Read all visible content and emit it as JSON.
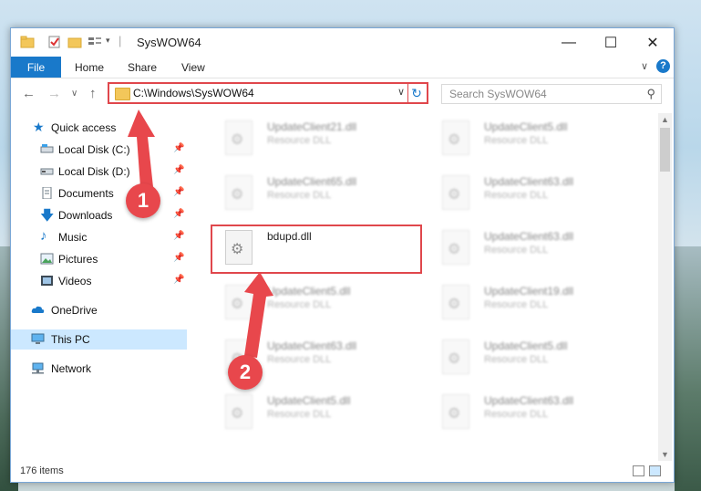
{
  "window": {
    "title": "SysWOW64"
  },
  "ribbon": {
    "file": "File",
    "home": "Home",
    "share": "Share",
    "view": "View",
    "help": "?"
  },
  "address": {
    "path": "C:\\Windows\\SysWOW64"
  },
  "search": {
    "placeholder": "Search SysWOW64"
  },
  "sidebar": {
    "items": [
      {
        "label": "Quick access",
        "icon": "star-icon"
      },
      {
        "label": "Local Disk (C:)",
        "icon": "disk-icon"
      },
      {
        "label": "Local Disk (D:)",
        "icon": "disk-icon"
      },
      {
        "label": "Documents",
        "icon": "documents-icon"
      },
      {
        "label": "Downloads",
        "icon": "download-icon"
      },
      {
        "label": "Music",
        "icon": "music-icon"
      },
      {
        "label": "Pictures",
        "icon": "pictures-icon"
      },
      {
        "label": "Videos",
        "icon": "videos-icon"
      },
      {
        "label": "OneDrive",
        "icon": "cloud-icon"
      },
      {
        "label": "This PC",
        "icon": "computer-icon"
      },
      {
        "label": "Network",
        "icon": "network-icon"
      }
    ]
  },
  "files": {
    "left": [
      {
        "name": "UpdateClient21.dll",
        "desc": "Resource DLL"
      },
      {
        "name": "UpdateClient65.dll",
        "desc": "Resource DLL"
      },
      {
        "name": "bdupd.dll",
        "desc": ""
      },
      {
        "name": "UpdateClient5.dll",
        "desc": "Resource DLL"
      },
      {
        "name": "UpdateClient63.dll",
        "desc": "Resource DLL"
      },
      {
        "name": "UpdateClient5.dll",
        "desc": "Resource DLL"
      }
    ],
    "right": [
      {
        "name": "UpdateClient5.dll",
        "desc": "Resource DLL"
      },
      {
        "name": "UpdateClient63.dll",
        "desc": "Resource DLL"
      },
      {
        "name": "UpdateClient63.dll",
        "desc": "Resource DLL"
      },
      {
        "name": "UpdateClient19.dll",
        "desc": "Resource DLL"
      },
      {
        "name": "UpdateClient5.dll",
        "desc": "Resource DLL"
      },
      {
        "name": "UpdateClient63.dll",
        "desc": "Resource DLL"
      }
    ]
  },
  "status": {
    "count": "176 items"
  },
  "callouts": {
    "one": "1",
    "two": "2"
  },
  "colors": {
    "accent": "#1979ca",
    "highlight": "#e0474c",
    "selected": "#cce8ff"
  }
}
